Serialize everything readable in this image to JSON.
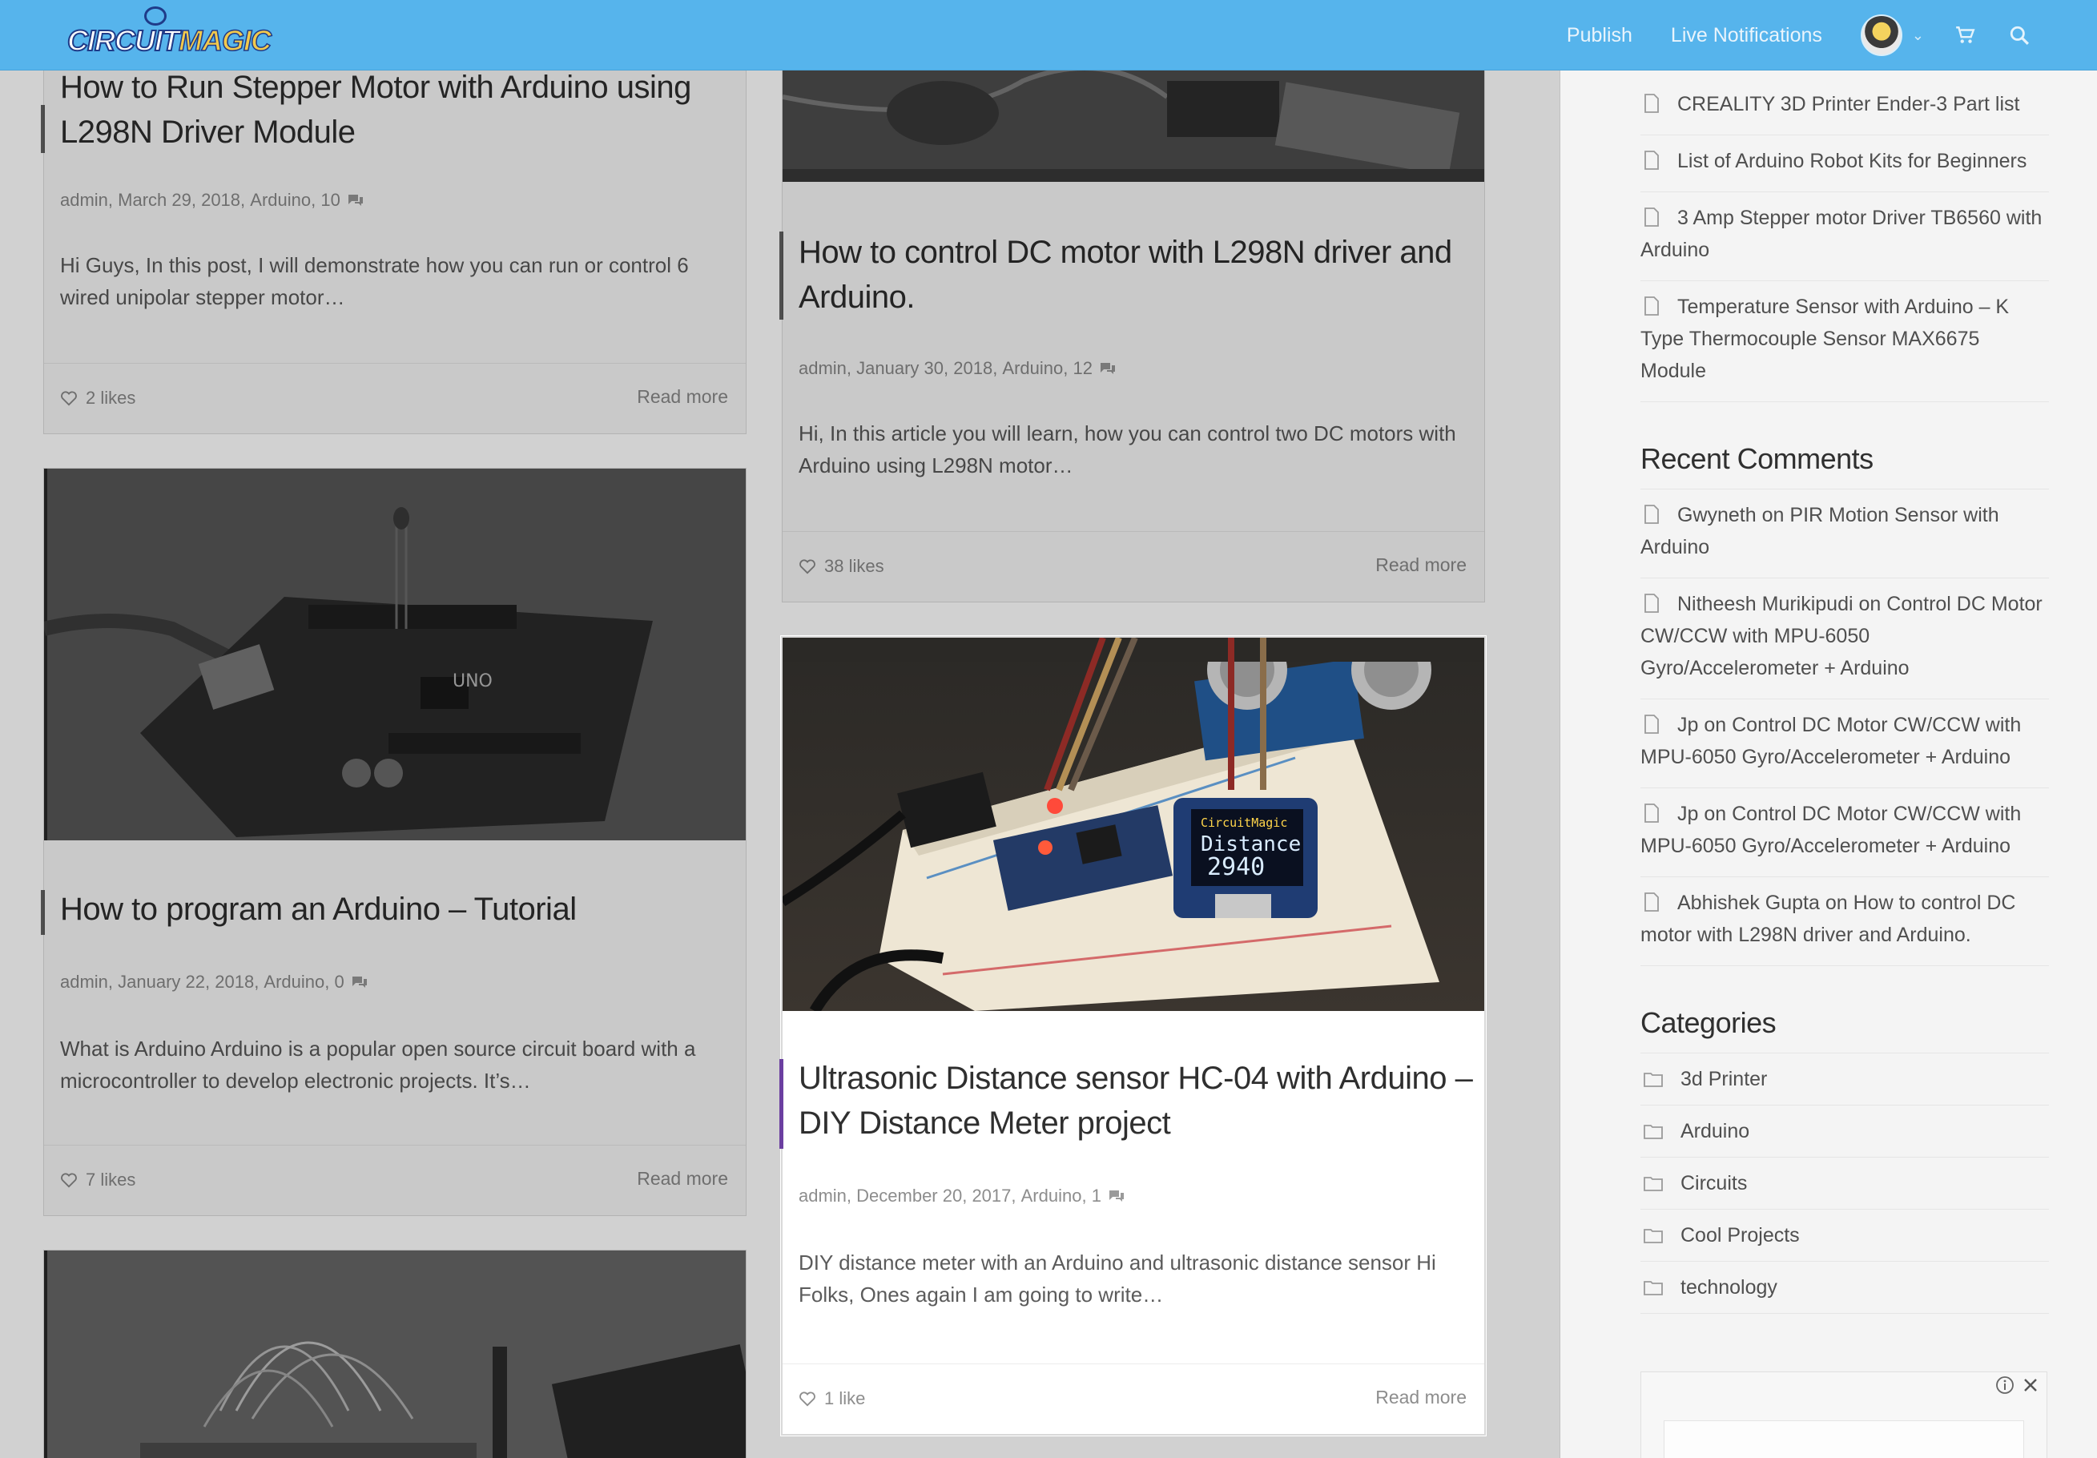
{
  "header": {
    "logo_part1": "CIRCUIT",
    "logo_part2": "MAGIC",
    "nav": [
      "Publish",
      "Live Notifications"
    ],
    "icons": [
      "avatar",
      "chevron-down-icon",
      "cart-icon",
      "search-icon"
    ]
  },
  "posts": [
    {
      "title": "How to Run Stepper Motor with Arduino using L298N Driver Module",
      "author": "admin",
      "date": "March 29, 2018",
      "category": "Arduino",
      "comments": "10",
      "excerpt": "Hi Guys, In this post, I will demonstrate how you can run or control 6 wired unipolar stepper motor…",
      "likes": "2 likes",
      "readmore": "Read more"
    },
    {
      "title": "How to control DC motor with L298N driver and Arduino.",
      "author": "admin",
      "date": "January 30, 2018",
      "category": "Arduino",
      "comments": "12",
      "excerpt": "Hi, In this article you will learn, how you can control two DC motors with Arduino using L298N motor…",
      "likes": "38 likes",
      "readmore": "Read more"
    },
    {
      "title": "How to program an Arduino – Tutorial",
      "author": "admin",
      "date": "January 22, 2018",
      "category": "Arduino",
      "comments": "0",
      "excerpt": "What is Arduino Arduino is a popular open source circuit board with a microcontroller to develop electronic projects. It’s…",
      "likes": "7 likes",
      "readmore": "Read more"
    },
    {
      "title": "Ultrasonic Distance sensor HC-04 with Arduino – DIY Distance Meter project",
      "author": "admin",
      "date": "December 20, 2017",
      "category": "Arduino",
      "comments": "1",
      "excerpt": "DIY  distance meter with an Arduino and ultrasonic distance sensor Hi Folks, Ones again I am going to write…",
      "likes": "1 like",
      "readmore": "Read more",
      "oled_brand": "CircuitMagic",
      "oled_label": "Distance",
      "oled_value": "2940"
    }
  ],
  "sidebar": {
    "recent_posts": [
      "CREALITY 3D Printer Ender-3 Part list",
      "List of Arduino Robot Kits for Beginners",
      "3 Amp Stepper motor Driver TB6560 with Arduino",
      "Temperature Sensor with Arduino – K Type Thermocouple Sensor MAX6675 Module"
    ],
    "recent_comments_title": "Recent Comments",
    "recent_comments": [
      {
        "author": "Gwyneth",
        "on": "on",
        "post": "PIR Motion Sensor with Arduino"
      },
      {
        "author": "Nitheesh Murikipudi",
        "on": "on",
        "post": "Control DC Motor CW/CCW with MPU-6050 Gyro/Accelerometer + Arduino"
      },
      {
        "author": "Jp",
        "on": "on",
        "post": "Control DC Motor CW/CCW with MPU-6050 Gyro/Accelerometer + Arduino"
      },
      {
        "author": "Jp",
        "on": "on",
        "post": "Control DC Motor CW/CCW with MPU-6050 Gyro/Accelerometer + Arduino"
      },
      {
        "author": "Abhishek Gupta",
        "on": "on",
        "post": "How to control DC motor with L298N driver and Arduino."
      }
    ],
    "categories_title": "Categories",
    "categories": [
      "3d Printer",
      "Arduino",
      "Circuits",
      "Cool Projects",
      "technology"
    ]
  },
  "colors": {
    "topbar": "#56b4ec",
    "accent_bar": "#6b3fa0",
    "text_title": "#2f2f2f",
    "text_meta": "#8d8d8d"
  }
}
